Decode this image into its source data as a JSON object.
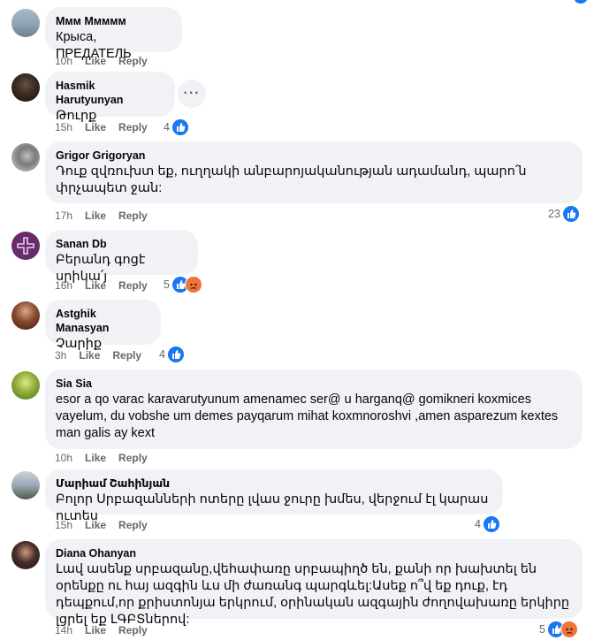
{
  "comments": [
    {
      "author": "Ммм Ммммм",
      "text": "Крыса, ПРЕДАТЕЛЬ",
      "time": "10h",
      "like": "Like",
      "reply": "Reply",
      "reactions": ""
    },
    {
      "author": "Hasmik Harutyunyan",
      "text": "Թուրք",
      "time": "15h",
      "like": "Like",
      "reply": "Reply",
      "reactions": "4"
    },
    {
      "author": "Grigor Grigoryan",
      "text": "Դուք զվռուխտ եք, ուղղակի անբարոյականության ադամանդ, պարո՛ն փրչապետ ջան:",
      "time": "17h",
      "like": "Like",
      "reply": "Reply",
      "reactions": "23"
    },
    {
      "author": "Sanan Db",
      "text": "Բերանդ գոցէ սրիկա՛յ",
      "time": "16h",
      "like": "Like",
      "reply": "Reply",
      "reactions": "5"
    },
    {
      "author": "Astghik Manasyan",
      "text": "Չարիք",
      "time": "3h",
      "like": "Like",
      "reply": "Reply",
      "reactions": "4"
    },
    {
      "author": "Sia Sia",
      "text": "esor a qo varac karavarutyunum amenamec ser@ u harganq@ gomikneri koxmices vayelum, du vobshe um demes payqarum mihat koxmnoroshvi ,amen asparezum kextes man galis ay kext",
      "time": "10h",
      "like": "Like",
      "reply": "Reply",
      "reactions": ""
    },
    {
      "author": "Մարիամ Շահինյան",
      "text": "Բոլոր Սրբազանների ոտերը լվաս ջուրը խմես, վերջում էլ կարաս ուտես",
      "time": "15h",
      "like": "Like",
      "reply": "Reply",
      "reactions": "4"
    },
    {
      "author": "Diana Ohanyan",
      "text": "Լավ ասենք սրբազանը,վեհափառը սրբապիղծ են, քանի որ խախտել են օրենքը ու հայ ազգին ևս մի ժառանգ պարգևել:Ասեք ո՞վ եք դուք, էդ դեպքում,որ քրիստոնյա երկրում, օրինական ազգային ժողովախառը երկիրը լցրել եք ԼԳԲՏներով:",
      "time": "14h",
      "like": "Like",
      "reply": "Reply",
      "reactions": "5"
    }
  ],
  "colors": {
    "like": "#1877f2",
    "angry": "#f0733a",
    "bubble": "#f0f2f5",
    "meta": "#65676b"
  }
}
